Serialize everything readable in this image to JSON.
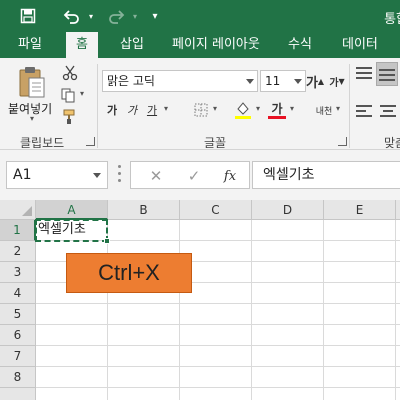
{
  "title_bar": {
    "title": "통합",
    "quick_access": {
      "more": "▾"
    }
  },
  "tabs": [
    {
      "label": "파일"
    },
    {
      "label": "홈"
    },
    {
      "label": "삽입"
    },
    {
      "label": "페이지 레이아웃"
    },
    {
      "label": "수식"
    },
    {
      "label": "데이터"
    }
  ],
  "ribbon": {
    "clipboard": {
      "paste_label": "붙여넣기",
      "group_label": "클립보드"
    },
    "font": {
      "font_name": "맑은 고딕",
      "font_size": "11",
      "bold": "가",
      "italic": "가",
      "underline": "가",
      "font_color_glyph": "가",
      "font_color_hex": "#e81123",
      "fill_color_hex": "#ffff00",
      "grow_font": "가",
      "shrink_font": "가",
      "group_label": "글꼴"
    },
    "alignment": {
      "wrap_label": "내천",
      "group_label": "맞춤"
    }
  },
  "formula_bar": {
    "name_box": "A1",
    "cancel": "✕",
    "enter": "✓",
    "fx": "fx",
    "content": "엑셀기초"
  },
  "sheet": {
    "columns": [
      "A",
      "B",
      "C",
      "D",
      "E"
    ],
    "rows": [
      "1",
      "2",
      "3",
      "4",
      "5",
      "6",
      "7",
      "8"
    ],
    "cell_a1": "엑셀기초",
    "accent_color": "#217346"
  },
  "overlay": {
    "shortcut_label": "Ctrl+X",
    "shortcut_color": "#ed7d31"
  }
}
